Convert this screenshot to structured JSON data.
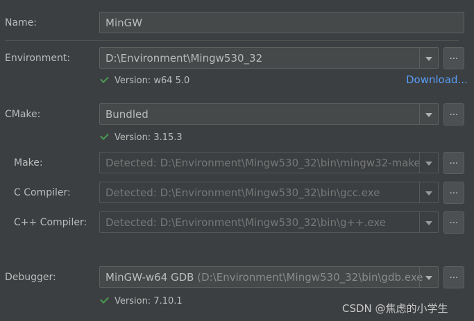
{
  "name": {
    "label": "Name:",
    "value": "MinGW"
  },
  "environment": {
    "label": "Environment:",
    "value": "D:\\Environment\\Mingw530_32",
    "browse": "...",
    "status": "Version: w64 5.0",
    "download_link": "Download..."
  },
  "cmake": {
    "label": "CMake:",
    "value": "Bundled",
    "browse": "...",
    "status": "Version: 3.15.3"
  },
  "make": {
    "label": "Make:",
    "value": "Detected: D:\\Environment\\Mingw530_32\\bin\\mingw32-make",
    "browse": "..."
  },
  "c_compiler": {
    "label": "C Compiler:",
    "value": "Detected: D:\\Environment\\Mingw530_32\\bin\\gcc.exe",
    "browse": "..."
  },
  "cpp_compiler": {
    "label": "C++ Compiler:",
    "value": "Detected: D:\\Environment\\Mingw530_32\\bin\\g++.exe",
    "browse": "..."
  },
  "debugger": {
    "label": "Debugger:",
    "value": "MinGW-w64 GDB",
    "path": "(D:\\Environment\\Mingw530_32\\bin\\gdb.exe",
    "browse": "...",
    "status": "Version: 7.10.1"
  },
  "watermark": "CSDN @焦虑的小学生",
  "colors": {
    "check": "#499c54",
    "link": "#589df6",
    "background": "#3c3f41"
  }
}
